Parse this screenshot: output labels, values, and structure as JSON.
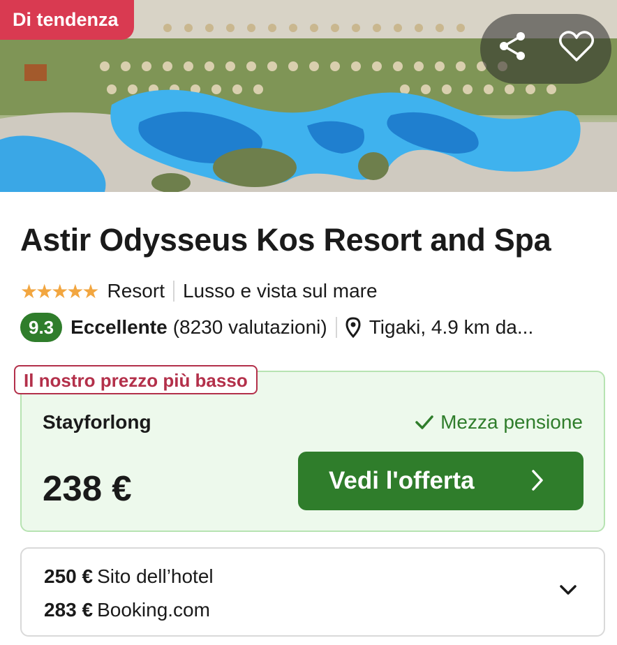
{
  "hero": {
    "badge": "Di tendenza",
    "share_icon": "share-icon",
    "favorite_icon": "heart-icon"
  },
  "hotel": {
    "name": "Astir Odysseus Kos Resort and Spa",
    "stars": 5,
    "stars_display": "★★★★★",
    "type": "Resort",
    "tagline": "Lusso e vista sul mare",
    "score": "9.3",
    "rating_label": "Eccellente",
    "reviews": "(8230 valutazioni)",
    "location": "Tigaki, 4.9 km da..."
  },
  "offer": {
    "lowest_label": "Il nostro prezzo più basso",
    "provider": "Stayforlong",
    "board": "Mezza pensione",
    "price": "238 €",
    "cta_label": "Vedi l'offerta",
    "accent_color": "#2f7d2b"
  },
  "other_prices": [
    {
      "price": "250 €",
      "provider": "Sito dell’hotel"
    },
    {
      "price": "283 €",
      "provider": "Booking.com"
    }
  ],
  "colors": {
    "trend_badge": "#d93a51",
    "lowest_label": "#b3304a",
    "offer_bg": "#edf9ec",
    "stars": "#f2a640"
  }
}
